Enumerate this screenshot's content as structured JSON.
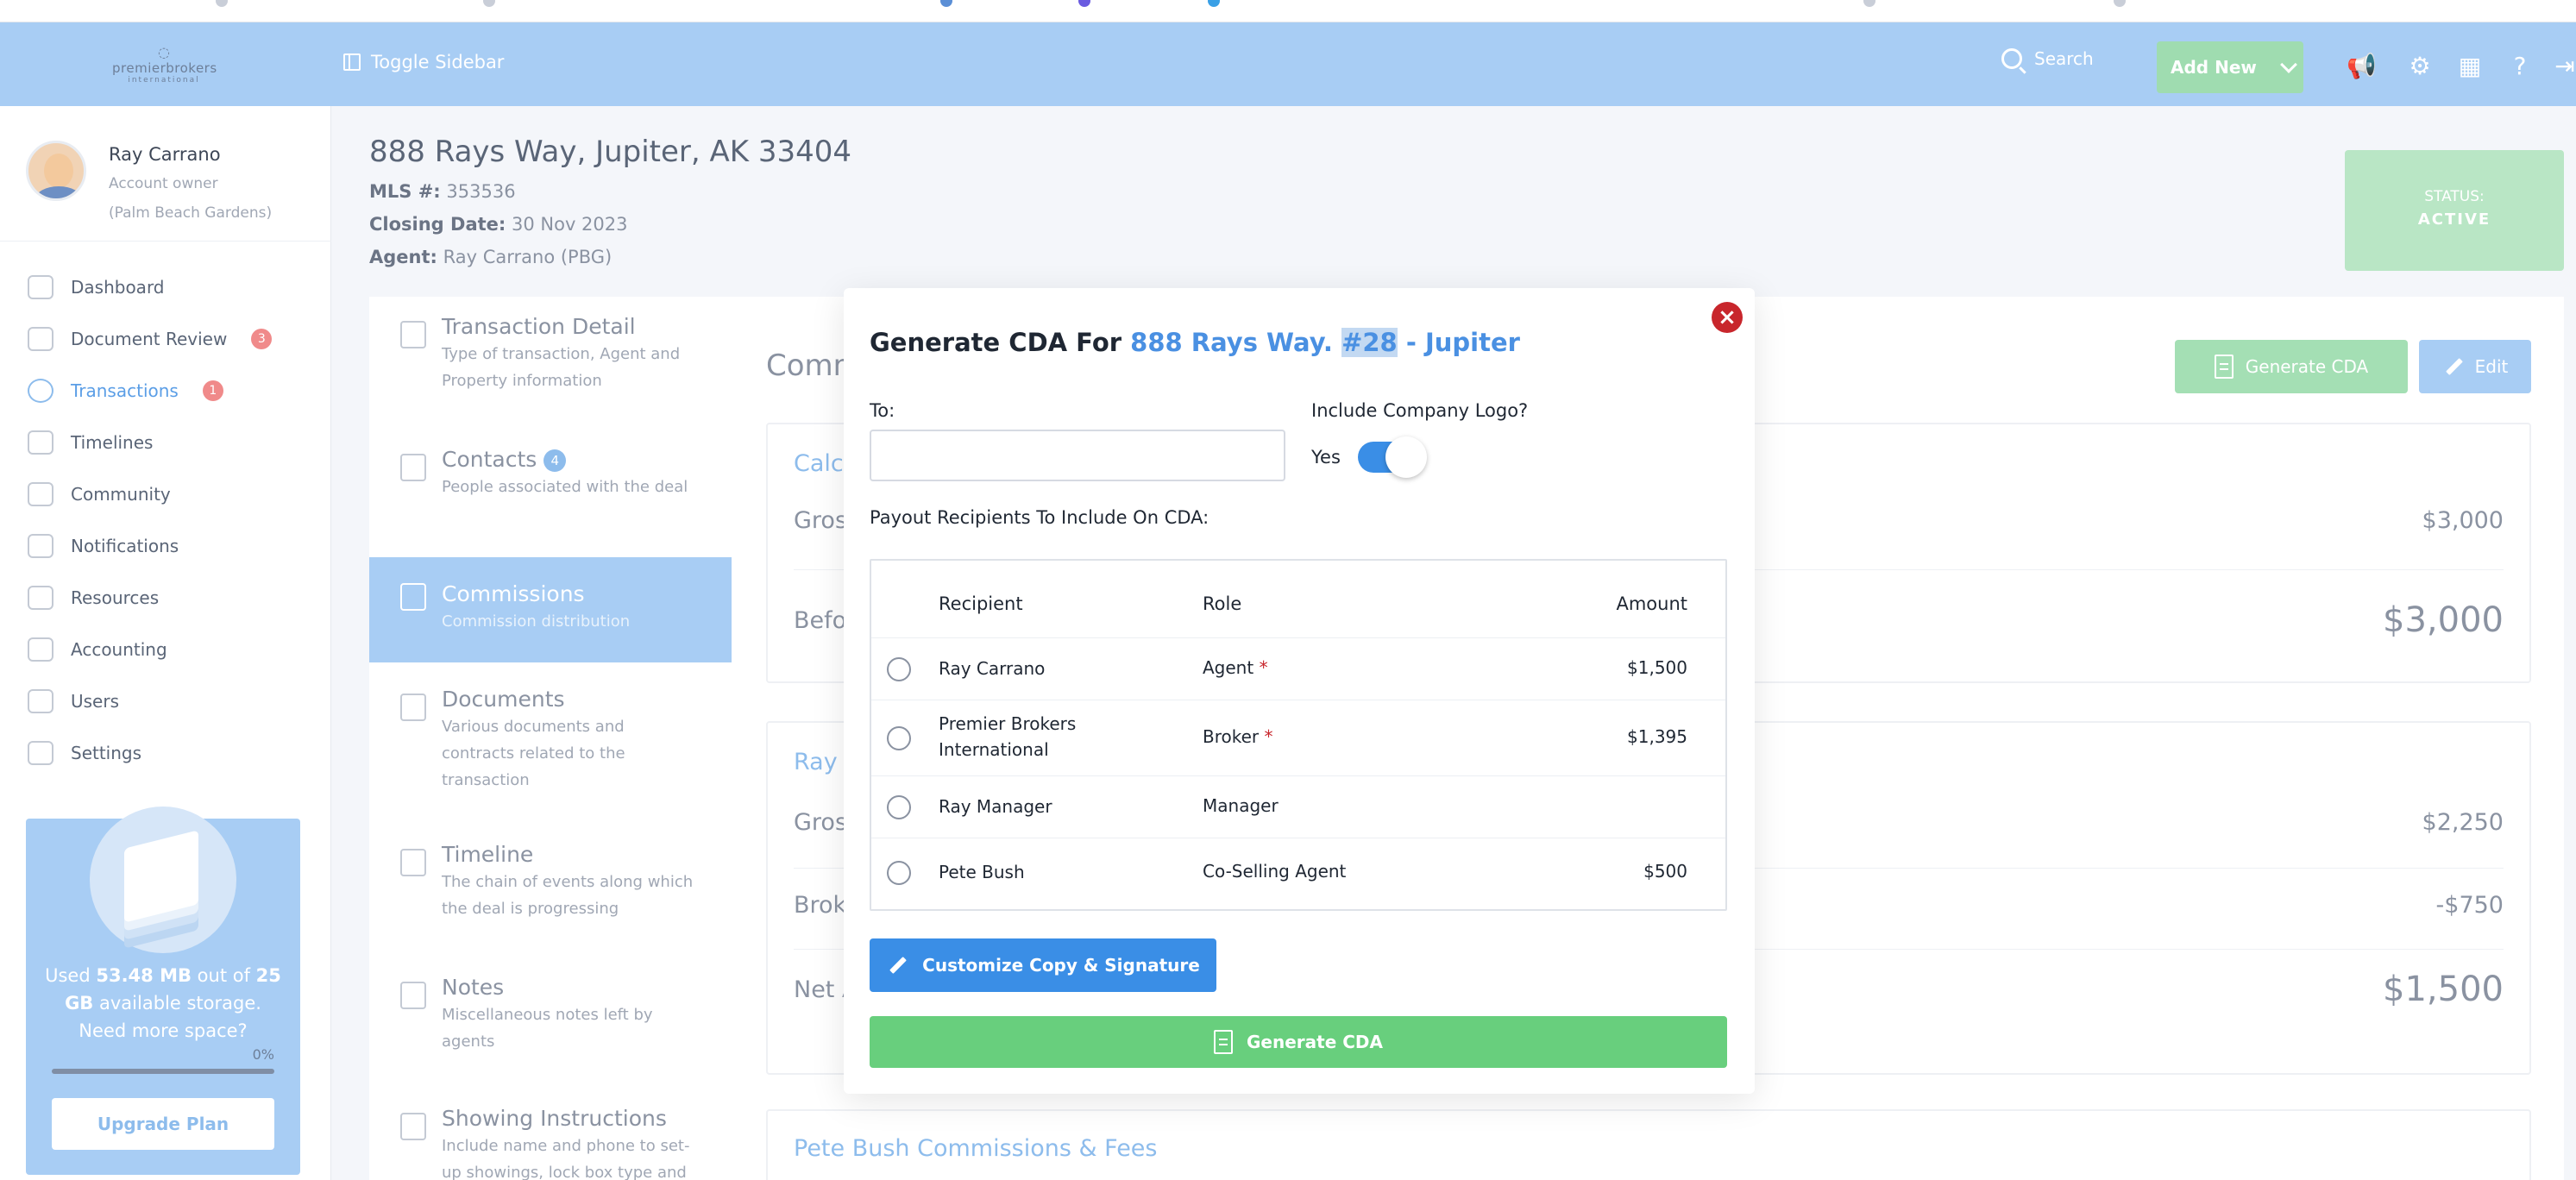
{
  "header": {
    "logo": {
      "name": "premierbrokers",
      "sub": "international"
    },
    "toggle_sidebar": "Toggle Sidebar",
    "search": "Search",
    "add_new": "Add New"
  },
  "profile": {
    "name": "Ray Carrano",
    "role": "Account owner",
    "location": "(Palm Beach Gardens)"
  },
  "sidebar": {
    "items": [
      {
        "label": "Dashboard",
        "badge": ""
      },
      {
        "label": "Document Review",
        "badge": "3"
      },
      {
        "label": "Transactions",
        "badge": "1"
      },
      {
        "label": "Timelines",
        "badge": ""
      },
      {
        "label": "Community",
        "badge": ""
      },
      {
        "label": "Notifications",
        "badge": ""
      },
      {
        "label": "Resources",
        "badge": ""
      },
      {
        "label": "Accounting",
        "badge": ""
      },
      {
        "label": "Users",
        "badge": ""
      },
      {
        "label": "Settings",
        "badge": ""
      }
    ],
    "storage": {
      "used_prefix": "Used",
      "used": "53.48 MB",
      "out_of": "out of",
      "total": "25 GB",
      "suffix": "available storage.",
      "prompt": "Need more space?",
      "percent": "0%",
      "upgrade": "Upgrade Plan"
    }
  },
  "property": {
    "title": "888 Rays Way, Jupiter, AK 33404",
    "mls_label": "MLS #:",
    "mls": "353536",
    "closing_label": "Closing Date:",
    "closing": "30 Nov 2023",
    "agent_label": "Agent:",
    "agent": "Ray Carrano (PBG)",
    "status_label": "STATUS:",
    "status": "ACTIVE"
  },
  "tabs": [
    {
      "title": "Transaction Detail",
      "desc": "Type of transaction, Agent and Property information",
      "badge": ""
    },
    {
      "title": "Contacts",
      "desc": "People associated with the deal",
      "badge": "4"
    },
    {
      "title": "Commissions",
      "desc": "Commission distribution",
      "badge": ""
    },
    {
      "title": "Documents",
      "desc": "Various documents and contracts related to the transaction",
      "badge": ""
    },
    {
      "title": "Timeline",
      "desc": "The chain of events along which the deal is progressing",
      "badge": ""
    },
    {
      "title": "Notes",
      "desc": "Miscellaneous notes left by agents",
      "badge": ""
    },
    {
      "title": "Showing Instructions",
      "desc": "Include name and phone to set-up showings, lock box type and code, Gated Entry Instructions",
      "badge": ""
    }
  ],
  "main": {
    "title": "Comm",
    "generate_cda": "Generate CDA",
    "edit": "Edit",
    "card1": {
      "heading": "Calc",
      "row1_label": "Gros",
      "row1_value": "$3,000",
      "row2_label": "Befo",
      "row2_value": "$3,000"
    },
    "card2": {
      "heading": "Ray",
      "row1_label": "Gros",
      "row1_value": "$2,250",
      "row2_label": "Brok",
      "row2_value": "-$750",
      "row3_label": "Net A",
      "row3_value": "$1,500"
    },
    "card3": {
      "heading": "Pete Bush Commissions & Fees"
    }
  },
  "modal": {
    "title_prefix": "Generate CDA For",
    "title_addr_a": "888 Rays Way.",
    "title_addr_hl": "#28",
    "title_addr_b": "- Jupiter",
    "to_label": "To:",
    "to_value": "",
    "logo_label": "Include Company Logo?",
    "logo_value": "Yes",
    "payout_label": "Payout Recipients To Include On CDA:",
    "columns": {
      "recipient": "Recipient",
      "role": "Role",
      "amount": "Amount"
    },
    "rows": [
      {
        "name": "Ray Carrano",
        "role": "Agent",
        "required": "*",
        "amount": "$1,500"
      },
      {
        "name": "Premier Brokers International",
        "role": "Broker",
        "required": "*",
        "amount": "$1,395"
      },
      {
        "name": "Ray Manager",
        "role": "Manager",
        "required": "",
        "amount": ""
      },
      {
        "name": "Pete Bush",
        "role": "Co-Selling Agent",
        "required": "",
        "amount": "$500"
      }
    ],
    "customize": "Customize Copy & Signature",
    "generate": "Generate CDA",
    "close": "×"
  },
  "colors": {
    "header": "#a8cdf4",
    "accent_blue": "#3a8ee6",
    "green": "#68cf7d",
    "close_red": "#c8262c"
  }
}
